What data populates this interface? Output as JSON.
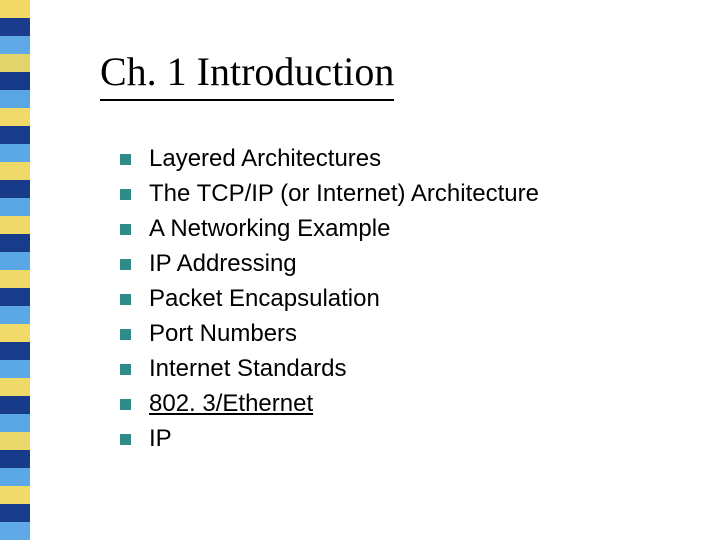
{
  "title": "Ch. 1 Introduction",
  "items": [
    {
      "text": "Layered Architectures",
      "underlined": false
    },
    {
      "text": "The TCP/IP (or Internet) Architecture",
      "underlined": false
    },
    {
      "text": "A Networking Example",
      "underlined": false
    },
    {
      "text": "IP Addressing",
      "underlined": false
    },
    {
      "text": "Packet Encapsulation",
      "underlined": false
    },
    {
      "text": "Port Numbers",
      "underlined": false
    },
    {
      "text": "Internet Standards",
      "underlined": false
    },
    {
      "text": "802. 3/Ethernet",
      "underlined": true
    },
    {
      "text": "IP",
      "underlined": false
    }
  ],
  "deco_colors": [
    "#f2d867",
    "#1b3c8c",
    "#5fa9e6",
    "#e0d46a",
    "#163a88",
    "#5aa6e4",
    "#f0da6a",
    "#193c8a",
    "#5ca8e5",
    "#efda69",
    "#173b89",
    "#5ba7e4",
    "#efda69",
    "#183c8a",
    "#5ba7e4",
    "#efda69",
    "#183c8a",
    "#5ca8e5",
    "#f0da6a",
    "#1a3d8b",
    "#5da9e6",
    "#efda69",
    "#173b89",
    "#5ba7e4",
    "#ead96a",
    "#173b89",
    "#5ca8e5",
    "#f0da6a",
    "#1a3d8b",
    "#5ea9e6"
  ]
}
